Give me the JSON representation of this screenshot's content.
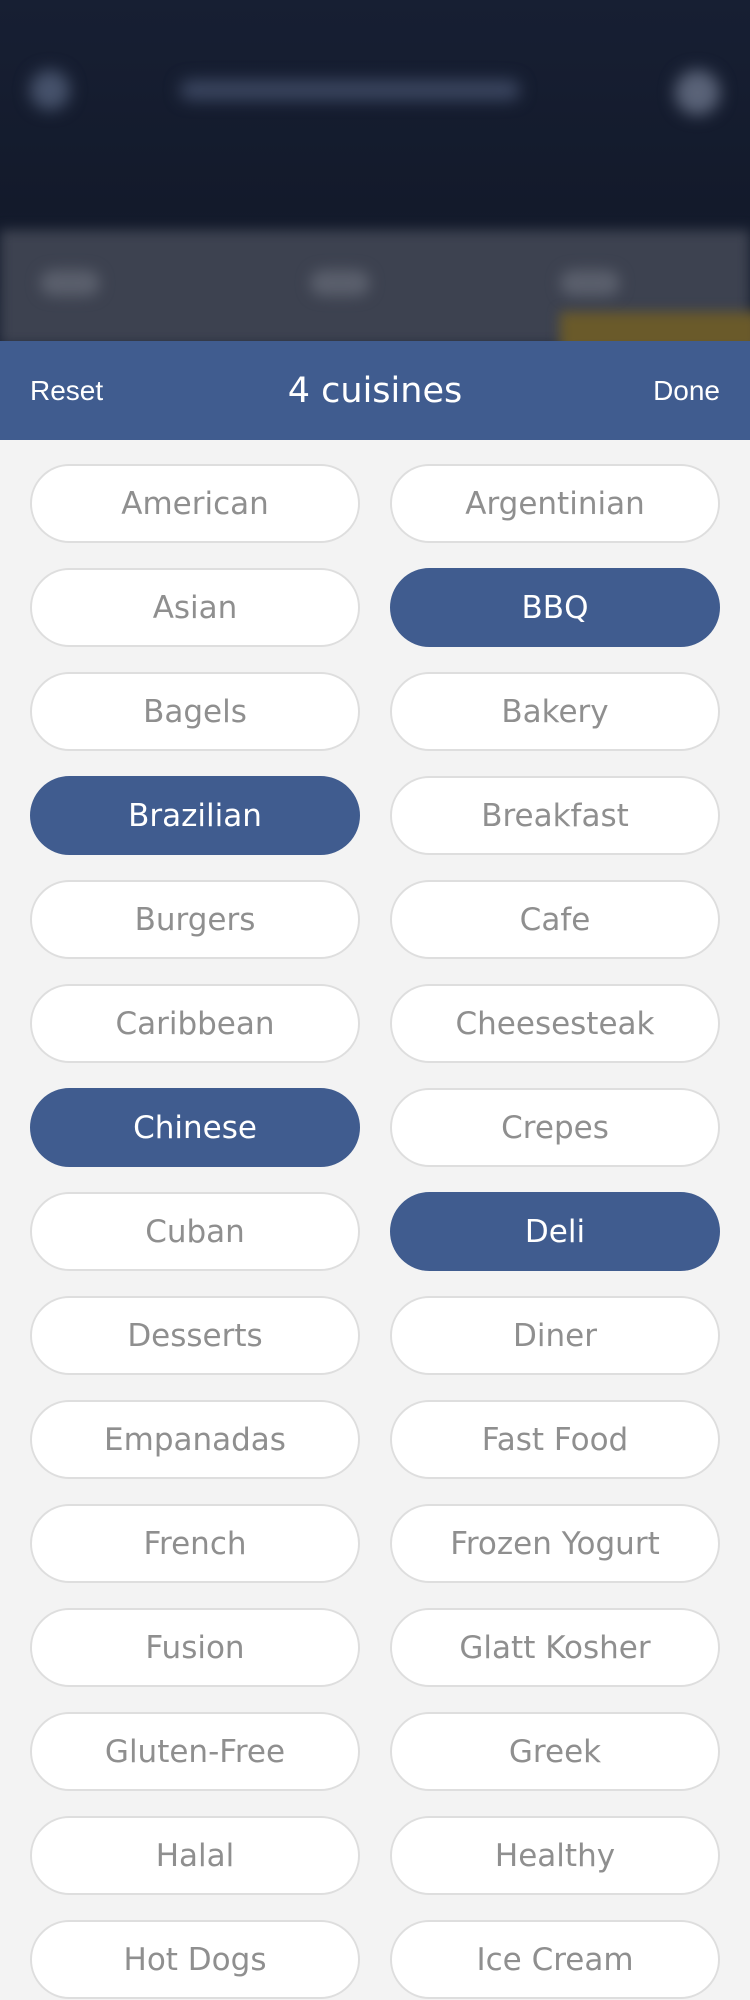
{
  "header": {
    "reset_label": "Reset",
    "title": "4 cuisines",
    "done_label": "Done"
  },
  "colors": {
    "accent": "#405c8f",
    "pill_text": "#8f8f8f",
    "pill_border": "#dedede",
    "background": "#f3f3f3"
  },
  "cuisines": [
    {
      "label": "American",
      "selected": false
    },
    {
      "label": "Argentinian",
      "selected": false
    },
    {
      "label": "Asian",
      "selected": false
    },
    {
      "label": "BBQ",
      "selected": true
    },
    {
      "label": "Bagels",
      "selected": false
    },
    {
      "label": "Bakery",
      "selected": false
    },
    {
      "label": "Brazilian",
      "selected": true
    },
    {
      "label": "Breakfast",
      "selected": false
    },
    {
      "label": "Burgers",
      "selected": false
    },
    {
      "label": "Cafe",
      "selected": false
    },
    {
      "label": "Caribbean",
      "selected": false
    },
    {
      "label": "Cheesesteak",
      "selected": false
    },
    {
      "label": "Chinese",
      "selected": true
    },
    {
      "label": "Crepes",
      "selected": false
    },
    {
      "label": "Cuban",
      "selected": false
    },
    {
      "label": "Deli",
      "selected": true
    },
    {
      "label": "Desserts",
      "selected": false
    },
    {
      "label": "Diner",
      "selected": false
    },
    {
      "label": "Empanadas",
      "selected": false
    },
    {
      "label": "Fast Food",
      "selected": false
    },
    {
      "label": "French",
      "selected": false
    },
    {
      "label": "Frozen Yogurt",
      "selected": false
    },
    {
      "label": "Fusion",
      "selected": false
    },
    {
      "label": "Glatt Kosher",
      "selected": false
    },
    {
      "label": "Gluten-Free",
      "selected": false
    },
    {
      "label": "Greek",
      "selected": false
    },
    {
      "label": "Halal",
      "selected": false
    },
    {
      "label": "Healthy",
      "selected": false
    },
    {
      "label": "Hot Dogs",
      "selected": false
    },
    {
      "label": "Ice Cream",
      "selected": false
    }
  ]
}
